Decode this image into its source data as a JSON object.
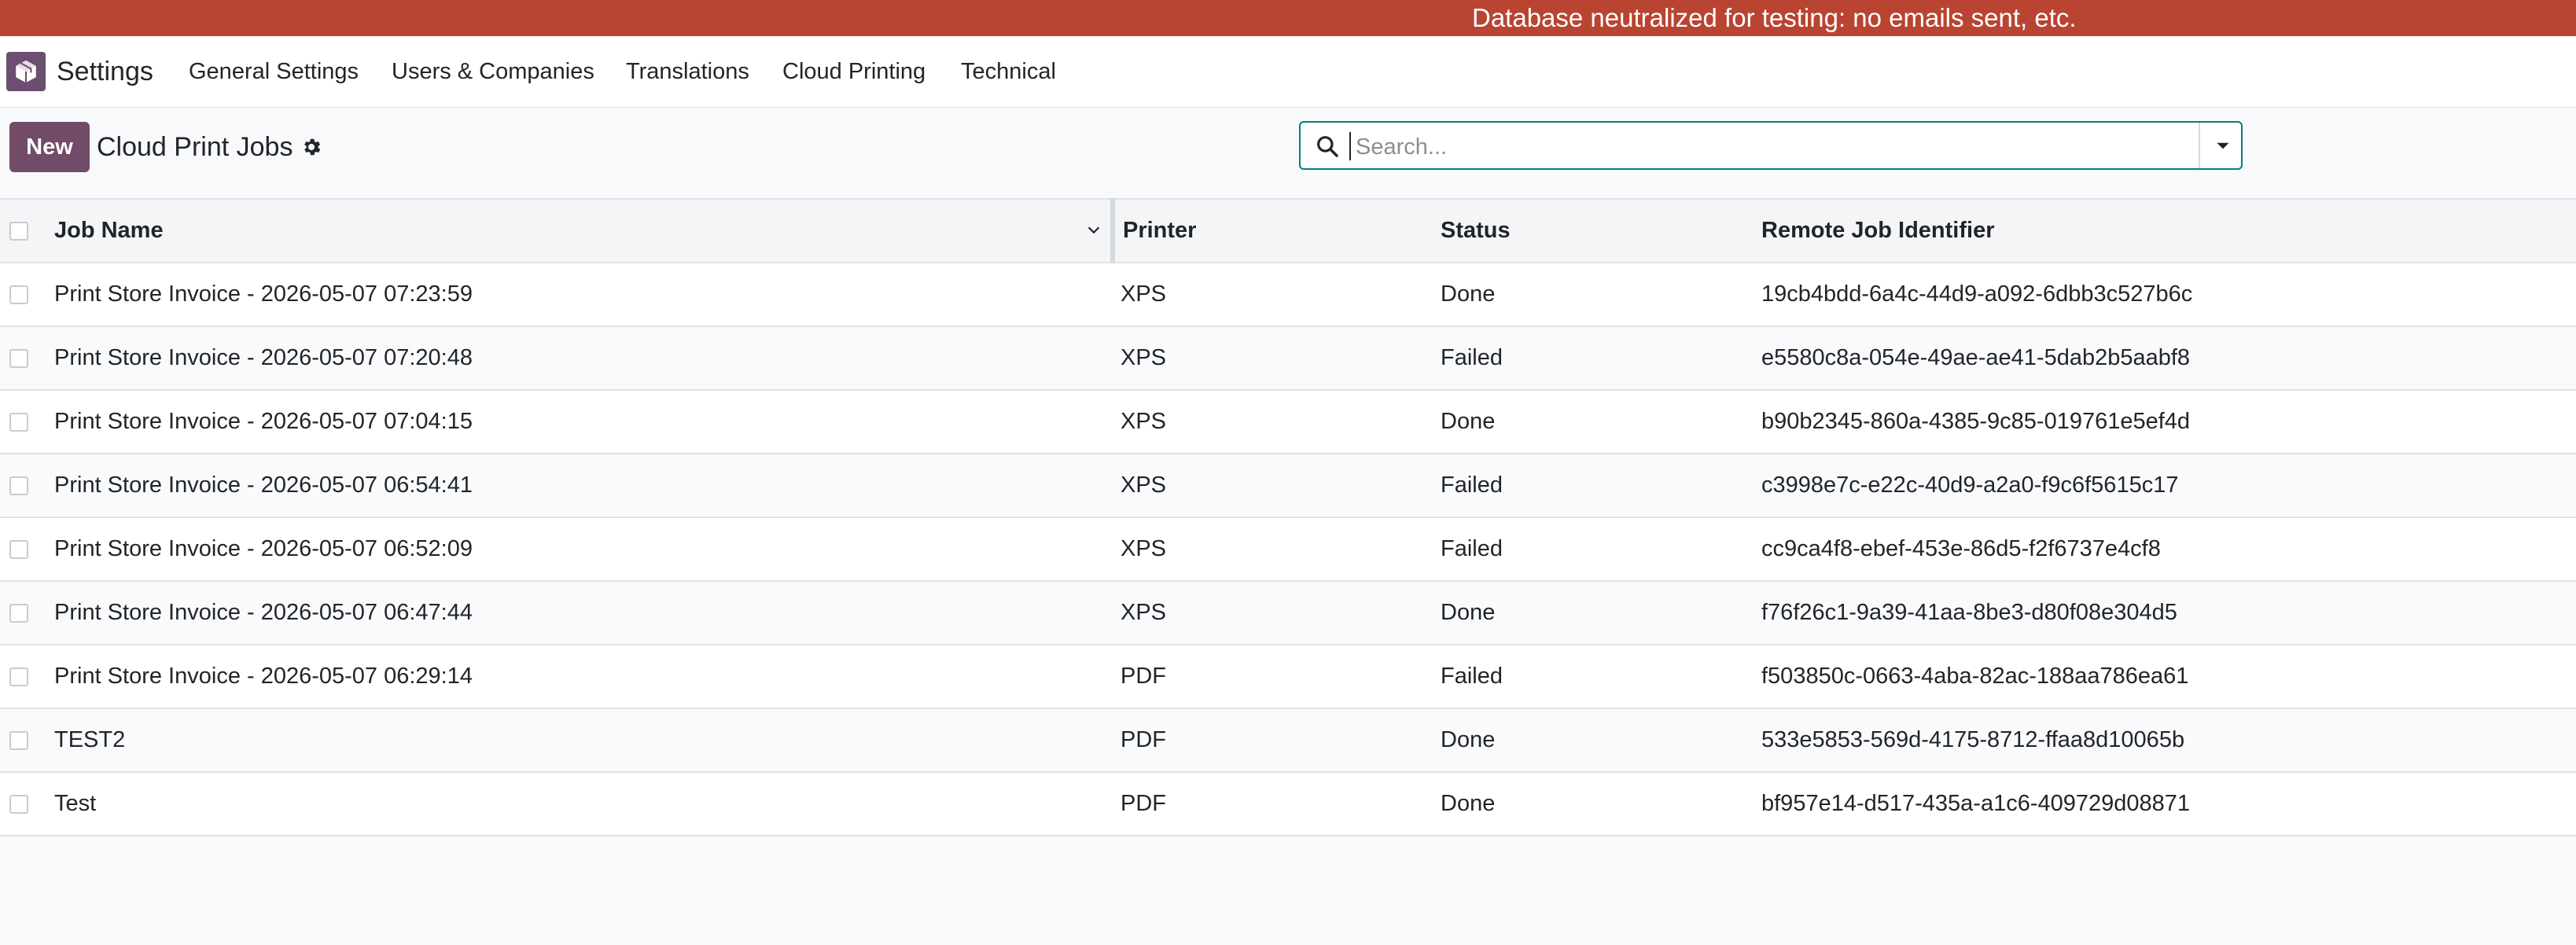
{
  "banner": {
    "text": "Database neutralized for testing: no emails sent, etc."
  },
  "nav": {
    "app_name": "Settings",
    "menu": [
      "General Settings",
      "Users & Companies",
      "Translations",
      "Cloud Printing",
      "Technical"
    ]
  },
  "control_panel": {
    "new_label": "New",
    "title": "Cloud Print Jobs",
    "search_placeholder": "Search..."
  },
  "table": {
    "columns": [
      "Job Name",
      "Printer",
      "Status",
      "Remote Job Identifier"
    ],
    "rows": [
      [
        "Print Store Invoice - 2026-05-07 07:23:59",
        "XPS",
        "Done",
        "19cb4bdd-6a4c-44d9-a092-6dbb3c527b6c"
      ],
      [
        "Print Store Invoice - 2026-05-07 07:20:48",
        "XPS",
        "Failed",
        "e5580c8a-054e-49ae-ae41-5dab2b5aabf8"
      ],
      [
        "Print Store Invoice - 2026-05-07 07:04:15",
        "XPS",
        "Done",
        "b90b2345-860a-4385-9c85-019761e5ef4d"
      ],
      [
        "Print Store Invoice - 2026-05-07 06:54:41",
        "XPS",
        "Failed",
        "c3998e7c-e22c-40d9-a2a0-f9c6f5615c17"
      ],
      [
        "Print Store Invoice - 2026-05-07 06:52:09",
        "XPS",
        "Failed",
        "cc9ca4f8-ebef-453e-86d5-f2f6737e4cf8"
      ],
      [
        "Print Store Invoice - 2026-05-07 06:47:44",
        "XPS",
        "Done",
        "f76f26c1-9a39-41aa-8be3-d80f08e304d5"
      ],
      [
        "Print Store Invoice - 2026-05-07 06:29:14",
        "PDF",
        "Failed",
        "f503850c-0663-4aba-82ac-188aa786ea61"
      ],
      [
        "TEST2",
        "PDF",
        "Done",
        "533e5853-569d-4175-8712-ffaa8d10065b"
      ],
      [
        "Test",
        "PDF",
        "Done",
        "bf957e14-d517-435a-a1c6-409729d08871"
      ]
    ]
  },
  "colors": {
    "banner": "#b94431",
    "brand": "#714b67",
    "search_border": "#017e84"
  },
  "icons": {
    "app": "box-icon",
    "gear": "gear-icon",
    "search": "search-icon",
    "dropdown": "caret-down-icon",
    "sort": "chevron-down-icon"
  }
}
